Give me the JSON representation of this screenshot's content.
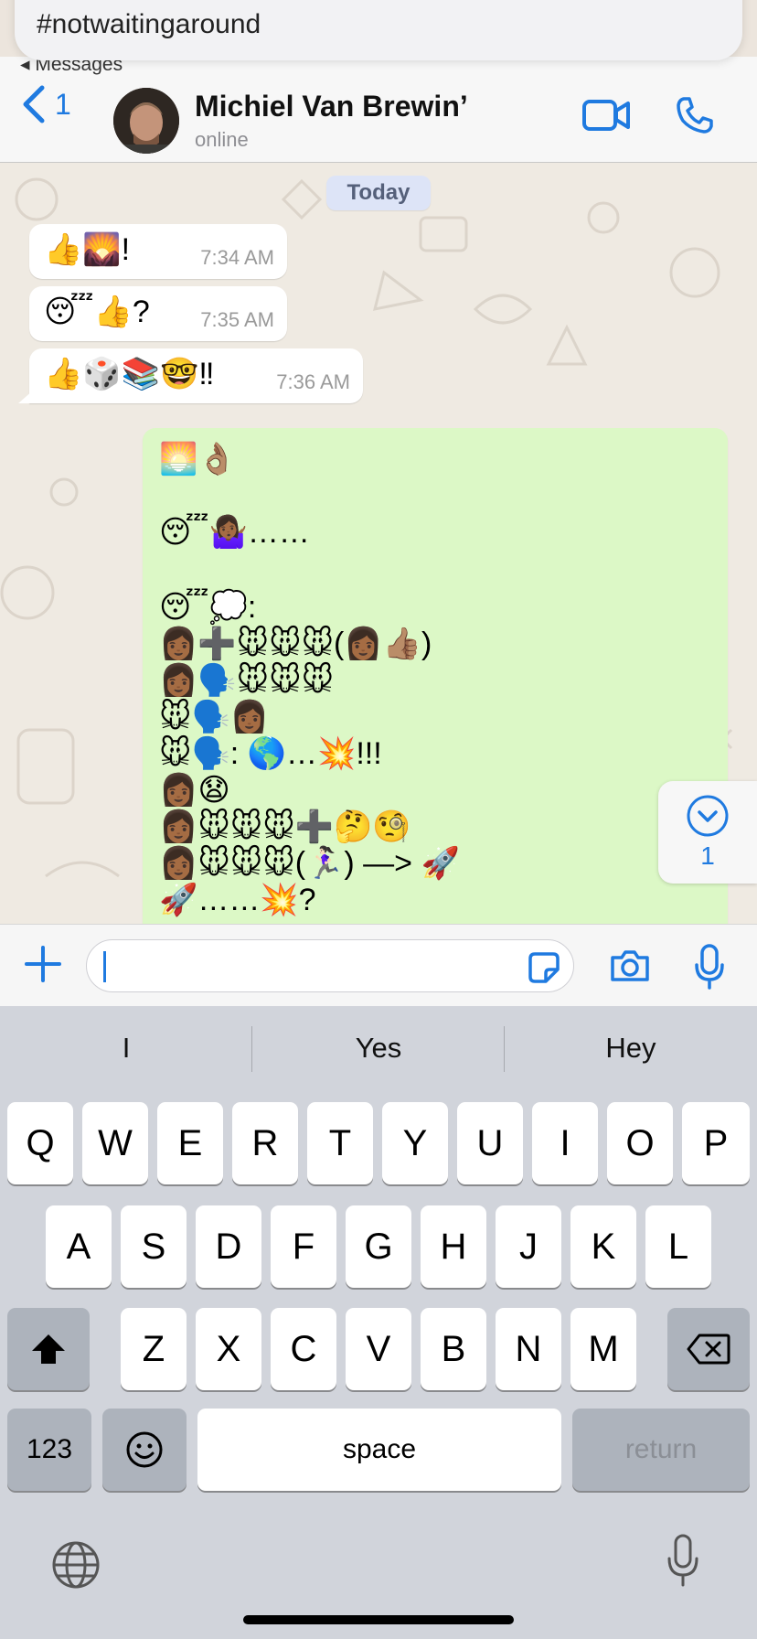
{
  "notification": {
    "text": "#notwaitingaround"
  },
  "return_app": {
    "label": "◂ Messages"
  },
  "header": {
    "back_count": "1",
    "contact_name": "Michiel Van Brewin’",
    "status": "online"
  },
  "chat": {
    "date_label": "Today",
    "incoming": [
      {
        "text": "👍🌄!",
        "time": "7:34 AM"
      },
      {
        "text": "😴👍?",
        "time": "7:35 AM"
      },
      {
        "text": "👍🎲📚🤓‼",
        "time": "7:36 AM"
      }
    ],
    "outgoing_lines": [
      "🌅👌🏽",
      "",
      "😴🤷🏾‍♀️……",
      "",
      "😴💭:",
      "👩🏾➕🐭🐭🐭(👩🏾👍🏽)",
      "👩🏾🗣️🐭🐭🐭",
      "🐭🗣️👩🏾",
      "🐭🗣️: 🌎…💥!!!",
      "👩🏾😧",
      "👩🏾🐭🐭🐭➕🤔🧐",
      "👩🏾🐭🐭🐭(🏃🏻‍♀️) —> 🚀",
      "🚀……💥?"
    ],
    "unread_badge": "1"
  },
  "input": {
    "placeholder": ""
  },
  "keyboard": {
    "suggestions": [
      "I",
      "Yes",
      "Hey"
    ],
    "row1": [
      "Q",
      "W",
      "E",
      "R",
      "T",
      "Y",
      "U",
      "I",
      "O",
      "P"
    ],
    "row2": [
      "A",
      "S",
      "D",
      "F",
      "G",
      "H",
      "J",
      "K",
      "L"
    ],
    "row3": [
      "Z",
      "X",
      "C",
      "V",
      "B",
      "N",
      "M"
    ],
    "numbers_label": "123",
    "space_label": "space",
    "return_label": "return"
  },
  "colors": {
    "accent": "#1f7ae0",
    "outgoing_bubble": "#dcf8c6",
    "incoming_bubble": "#ffffff",
    "chat_bg": "#efeae2",
    "keyboard_bg": "#d1d4db"
  }
}
